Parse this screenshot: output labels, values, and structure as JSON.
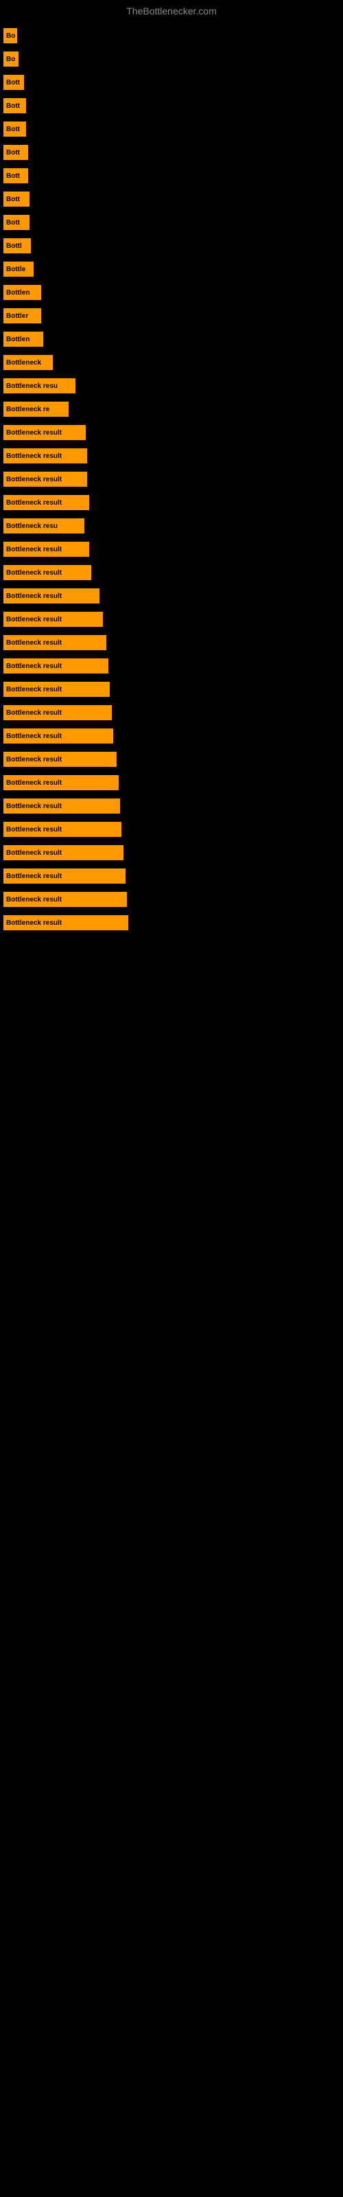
{
  "site": {
    "title": "TheBottlenecker.com"
  },
  "bars": [
    {
      "label": "Bo",
      "width": 20
    },
    {
      "label": "Bo",
      "width": 22
    },
    {
      "label": "Bott",
      "width": 30
    },
    {
      "label": "Bott",
      "width": 33
    },
    {
      "label": "Bott",
      "width": 33
    },
    {
      "label": "Bott",
      "width": 36
    },
    {
      "label": "Bott",
      "width": 36
    },
    {
      "label": "Bott",
      "width": 38
    },
    {
      "label": "Bott",
      "width": 38
    },
    {
      "label": "Bottl",
      "width": 40
    },
    {
      "label": "Bottle",
      "width": 44
    },
    {
      "label": "Bottlen",
      "width": 55
    },
    {
      "label": "Bottler",
      "width": 55
    },
    {
      "label": "Bottlen",
      "width": 58
    },
    {
      "label": "Bottleneck",
      "width": 72
    },
    {
      "label": "Bottleneck resu",
      "width": 105
    },
    {
      "label": "Bottleneck re",
      "width": 95
    },
    {
      "label": "Bottleneck result",
      "width": 120
    },
    {
      "label": "Bottleneck result",
      "width": 122
    },
    {
      "label": "Bottleneck result",
      "width": 122
    },
    {
      "label": "Bottleneck result",
      "width": 125
    },
    {
      "label": "Bottleneck resu",
      "width": 118
    },
    {
      "label": "Bottleneck result",
      "width": 125
    },
    {
      "label": "Bottleneck result",
      "width": 128
    },
    {
      "label": "Bottleneck result",
      "width": 140
    },
    {
      "label": "Bottleneck result",
      "width": 145
    },
    {
      "label": "Bottleneck result",
      "width": 150
    },
    {
      "label": "Bottleneck result",
      "width": 153
    },
    {
      "label": "Bottleneck result",
      "width": 155
    },
    {
      "label": "Bottleneck result",
      "width": 158
    },
    {
      "label": "Bottleneck result",
      "width": 160
    },
    {
      "label": "Bottleneck result",
      "width": 165
    },
    {
      "label": "Bottleneck result",
      "width": 168
    },
    {
      "label": "Bottleneck result",
      "width": 170
    },
    {
      "label": "Bottleneck result",
      "width": 172
    },
    {
      "label": "Bottleneck result",
      "width": 175
    },
    {
      "label": "Bottleneck result",
      "width": 178
    },
    {
      "label": "Bottleneck result",
      "width": 180
    },
    {
      "label": "Bottleneck result",
      "width": 182
    }
  ]
}
